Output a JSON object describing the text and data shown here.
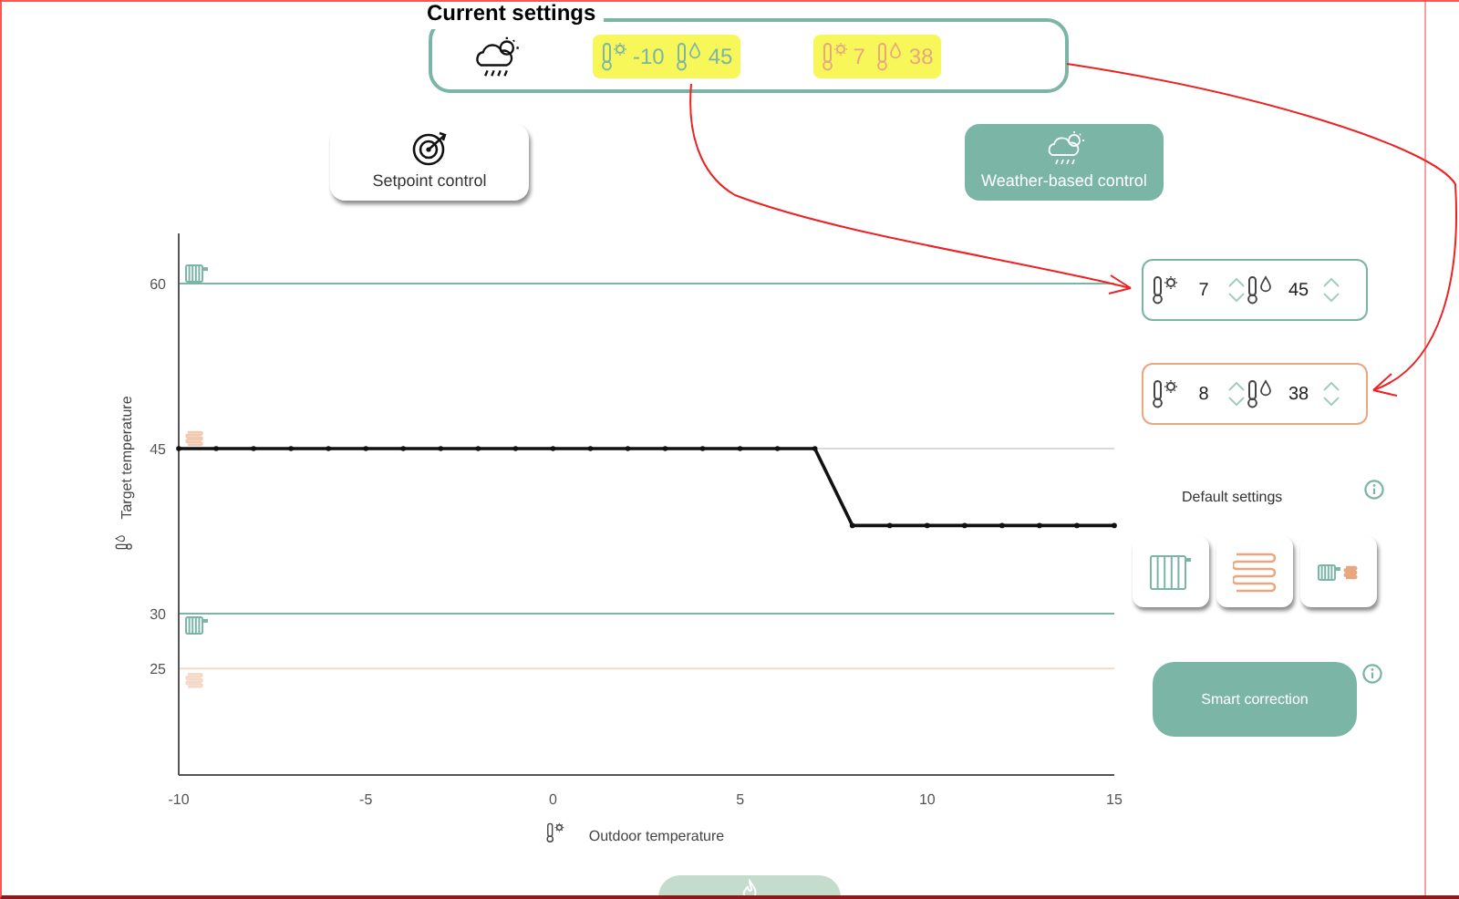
{
  "current_settings": {
    "title": "Current settings",
    "groups": [
      {
        "color": "#7ab5a6",
        "outdoor": "-10",
        "target": "45",
        "highlighted": true
      },
      {
        "color": "#e9a77f",
        "outdoor": "7",
        "target": "38",
        "highlighted": true
      }
    ]
  },
  "mode_buttons": [
    {
      "kind": "setpoint",
      "label": "Setpoint control",
      "selected": false
    },
    {
      "kind": "weather",
      "label": "Weather-based control",
      "selected": true
    }
  ],
  "curve_points": [
    {
      "color": "#7ab5a6",
      "outdoor": "7",
      "target": "45"
    },
    {
      "color": "#e9a77f",
      "outdoor": "8",
      "target": "38"
    }
  ],
  "default_settings": {
    "label": "Default settings",
    "options": [
      {
        "kind": "radiator"
      },
      {
        "kind": "floor"
      },
      {
        "kind": "combined"
      }
    ]
  },
  "smart_correction": {
    "label": "Smart correction"
  },
  "chart": {
    "chart_data": {
      "type": "line",
      "xlabel": "Outdoor temperature",
      "ylabel": "Target temperature",
      "x": [
        -10,
        -9,
        -8,
        -7,
        -6,
        -5,
        -4,
        -3,
        -2,
        -1,
        0,
        1,
        2,
        3,
        4,
        5,
        6,
        7,
        8,
        9,
        10,
        11,
        12,
        13,
        14,
        15
      ],
      "series": [
        {
          "color": "#111111",
          "values": [
            45,
            45,
            45,
            45,
            45,
            45,
            45,
            45,
            45,
            45,
            45,
            45,
            45,
            45,
            45,
            45,
            45,
            45,
            38,
            38,
            38,
            38,
            38,
            38,
            38,
            38
          ]
        }
      ],
      "xlim": [
        -10,
        15
      ],
      "ylim": [
        15,
        65
      ],
      "xticks": [
        -10,
        -5,
        0,
        5,
        10,
        15
      ],
      "yticks": [
        25,
        30,
        45,
        60
      ],
      "ref_lines": [
        {
          "axis": "y",
          "value": 60,
          "color": "#7ab5a6"
        },
        {
          "axis": "y",
          "value": 45,
          "color": "#d9d9d9"
        },
        {
          "axis": "y",
          "value": 30,
          "color": "#7ab5a6"
        },
        {
          "axis": "y",
          "value": 25,
          "color": "#f3d9c8"
        }
      ]
    }
  }
}
